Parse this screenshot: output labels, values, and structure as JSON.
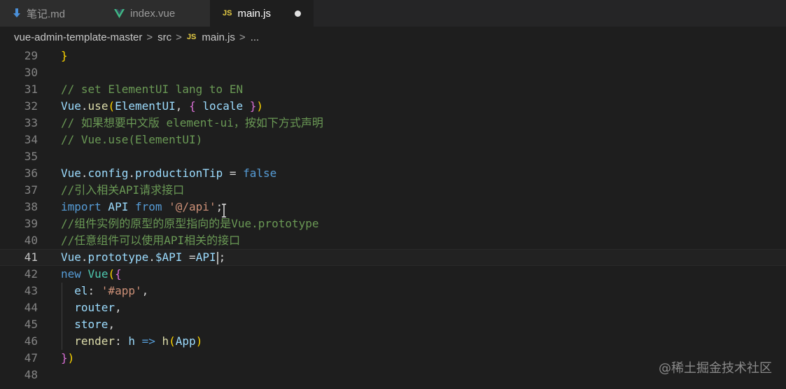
{
  "tabs": [
    {
      "label": "笔记.md",
      "icon": "markdown-arrow-icon"
    },
    {
      "label": "index.vue",
      "icon": "vue-icon"
    },
    {
      "label": "main.js",
      "icon": "js-icon",
      "badge": "JS",
      "modified": true
    }
  ],
  "breadcrumb": {
    "folder1": "vue-admin-template-master",
    "folder2": "src",
    "file_badge": "JS",
    "file": "main.js",
    "more": "...",
    "separator": ">"
  },
  "code_lines": [
    {
      "num": "29",
      "tokens": [
        {
          "t": "}",
          "c": "br1"
        }
      ]
    },
    {
      "num": "30",
      "tokens": []
    },
    {
      "num": "31",
      "tokens": [
        {
          "t": "// set ElementUI lang to EN",
          "c": "com"
        }
      ]
    },
    {
      "num": "32",
      "tokens": [
        {
          "t": "Vue",
          "c": "var"
        },
        {
          "t": ".",
          "c": "txt"
        },
        {
          "t": "use",
          "c": "fn"
        },
        {
          "t": "(",
          "c": "br1"
        },
        {
          "t": "ElementUI",
          "c": "var"
        },
        {
          "t": ", ",
          "c": "txt"
        },
        {
          "t": "{",
          "c": "br2"
        },
        {
          "t": " locale ",
          "c": "var"
        },
        {
          "t": "}",
          "c": "br2"
        },
        {
          "t": ")",
          "c": "br1"
        }
      ]
    },
    {
      "num": "33",
      "tokens": [
        {
          "t": "// 如果想要中文版 element-ui，按如下方式声明",
          "c": "com"
        }
      ]
    },
    {
      "num": "34",
      "tokens": [
        {
          "t": "// Vue.use(ElementUI)",
          "c": "com"
        }
      ]
    },
    {
      "num": "35",
      "tokens": []
    },
    {
      "num": "36",
      "tokens": [
        {
          "t": "Vue",
          "c": "var"
        },
        {
          "t": ".",
          "c": "txt"
        },
        {
          "t": "config",
          "c": "var"
        },
        {
          "t": ".",
          "c": "txt"
        },
        {
          "t": "productionTip",
          "c": "var"
        },
        {
          "t": " = ",
          "c": "op"
        },
        {
          "t": "false",
          "c": "kw"
        }
      ]
    },
    {
      "num": "37",
      "tokens": [
        {
          "t": "//引入相关API请求接口",
          "c": "com"
        }
      ]
    },
    {
      "num": "38",
      "tokens": [
        {
          "t": "import",
          "c": "kw"
        },
        {
          "t": " API ",
          "c": "var"
        },
        {
          "t": "from",
          "c": "kw"
        },
        {
          "t": " ",
          "c": "txt"
        },
        {
          "t": "'@/api'",
          "c": "str"
        },
        {
          "t": ";",
          "c": "txt"
        }
      ]
    },
    {
      "num": "39",
      "tokens": [
        {
          "t": "//组件实例的原型的原型指向的是Vue.prototype",
          "c": "com"
        }
      ]
    },
    {
      "num": "40",
      "tokens": [
        {
          "t": "//任意组件可以使用API相关的接口",
          "c": "com"
        }
      ]
    },
    {
      "num": "41",
      "current": true,
      "tokens": [
        {
          "t": "Vue",
          "c": "var"
        },
        {
          "t": ".",
          "c": "txt"
        },
        {
          "t": "prototype",
          "c": "var"
        },
        {
          "t": ".",
          "c": "txt"
        },
        {
          "t": "$API",
          "c": "var"
        },
        {
          "t": " =",
          "c": "op"
        },
        {
          "t": "API",
          "c": "var"
        },
        {
          "t": "|caret|",
          "c": "caret"
        },
        {
          "t": ";",
          "c": "txt"
        }
      ]
    },
    {
      "num": "42",
      "tokens": [
        {
          "t": "new",
          "c": "kw"
        },
        {
          "t": " ",
          "c": "txt"
        },
        {
          "t": "Vue",
          "c": "cls"
        },
        {
          "t": "(",
          "c": "br1"
        },
        {
          "t": "{",
          "c": "br2"
        }
      ]
    },
    {
      "num": "43",
      "tokens": [
        {
          "t": "  el",
          "c": "var"
        },
        {
          "t": ": ",
          "c": "txt"
        },
        {
          "t": "'#app'",
          "c": "str"
        },
        {
          "t": ",",
          "c": "txt"
        }
      ]
    },
    {
      "num": "44",
      "tokens": [
        {
          "t": "  router",
          "c": "var"
        },
        {
          "t": ",",
          "c": "txt"
        }
      ]
    },
    {
      "num": "45",
      "tokens": [
        {
          "t": "  store",
          "c": "var"
        },
        {
          "t": ",",
          "c": "txt"
        }
      ]
    },
    {
      "num": "46",
      "tokens": [
        {
          "t": "  render",
          "c": "fn"
        },
        {
          "t": ": ",
          "c": "txt"
        },
        {
          "t": "h",
          "c": "var"
        },
        {
          "t": " => ",
          "c": "kw"
        },
        {
          "t": "h",
          "c": "fn"
        },
        {
          "t": "(",
          "c": "br1"
        },
        {
          "t": "App",
          "c": "var"
        },
        {
          "t": ")",
          "c": "br1"
        }
      ]
    },
    {
      "num": "47",
      "tokens": [
        {
          "t": "}",
          "c": "br2"
        },
        {
          "t": ")",
          "c": "br1"
        }
      ]
    },
    {
      "num": "48",
      "tokens": []
    }
  ],
  "watermark": "@稀土掘金技术社区",
  "colors": {
    "editor_bg": "#1e1e1e",
    "comment": "#6a9955",
    "keyword": "#569cd6",
    "string": "#ce9178",
    "variable": "#9cdcfe",
    "function": "#dcdcaa",
    "bracket_gold": "#ffd700",
    "bracket_purple": "#da70d6",
    "js_badge": "#e6cd45",
    "vue_green": "#41b883"
  }
}
